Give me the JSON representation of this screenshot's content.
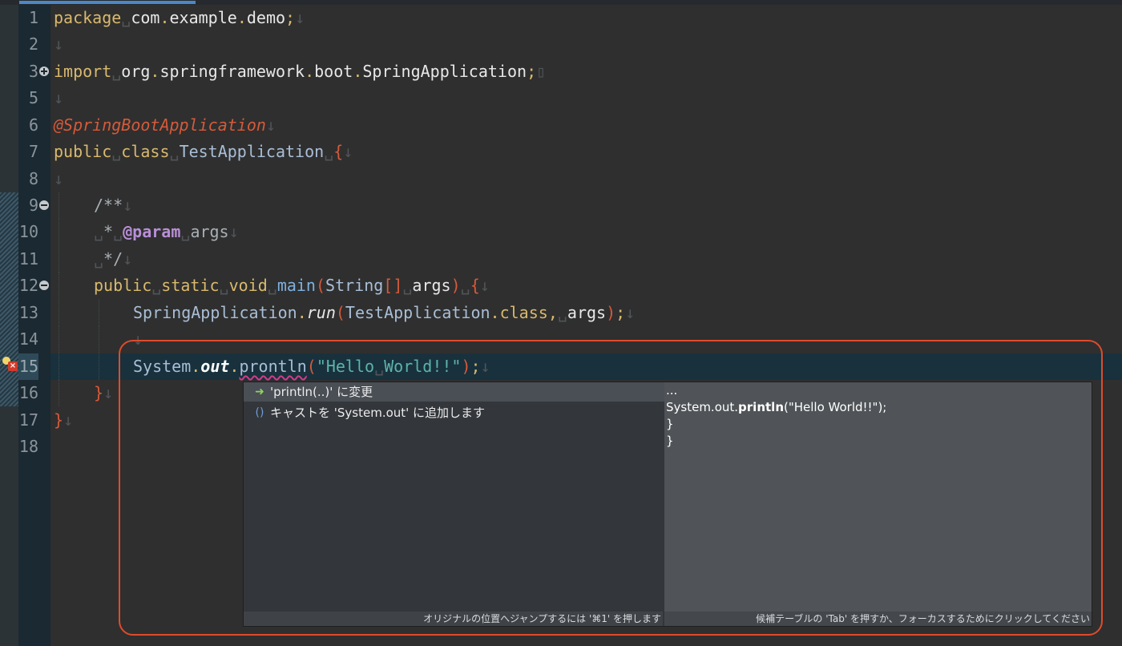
{
  "editor": {
    "lines": [
      {
        "number": "1",
        "tokens": [
          {
            "t": "package",
            "c": "kw"
          },
          {
            "t": "␣",
            "c": "ws"
          },
          {
            "t": "com",
            "c": "var"
          },
          {
            "t": ".",
            "c": "kw"
          },
          {
            "t": "example",
            "c": "var"
          },
          {
            "t": ".",
            "c": "kw"
          },
          {
            "t": "demo",
            "c": "var"
          },
          {
            "t": ";",
            "c": "kw"
          },
          {
            "t": "↓",
            "c": "ws"
          }
        ]
      },
      {
        "number": "2",
        "tokens": [
          {
            "t": "↓",
            "c": "ws"
          }
        ]
      },
      {
        "number": "3",
        "fold": "plus",
        "tokens": [
          {
            "t": "import",
            "c": "kw"
          },
          {
            "t": "␣",
            "c": "ws"
          },
          {
            "t": "org",
            "c": "var"
          },
          {
            "t": ".",
            "c": "kw"
          },
          {
            "t": "springframework",
            "c": "var"
          },
          {
            "t": ".",
            "c": "kw"
          },
          {
            "t": "boot",
            "c": "var"
          },
          {
            "t": ".",
            "c": "kw"
          },
          {
            "t": "SpringApplication",
            "c": "var"
          },
          {
            "t": ";",
            "c": "kw"
          },
          {
            "t": "▯",
            "c": "ws"
          }
        ]
      },
      {
        "number": "5",
        "tokens": [
          {
            "t": "↓",
            "c": "ws"
          }
        ]
      },
      {
        "number": "6",
        "tokens": [
          {
            "t": "@SpringBootApplication",
            "c": "an"
          },
          {
            "t": "↓",
            "c": "ws"
          }
        ]
      },
      {
        "number": "7",
        "tokens": [
          {
            "t": "public",
            "c": "kw"
          },
          {
            "t": "␣",
            "c": "ws"
          },
          {
            "t": "class",
            "c": "kw"
          },
          {
            "t": "␣",
            "c": "ws"
          },
          {
            "t": "TestApplication",
            "c": "cls"
          },
          {
            "t": "␣",
            "c": "ws"
          },
          {
            "t": "{",
            "c": "br"
          },
          {
            "t": "↓",
            "c": "ws"
          }
        ]
      },
      {
        "number": "8",
        "tokens": [
          {
            "t": "↓",
            "c": "ws"
          }
        ]
      },
      {
        "number": "9",
        "fold": "minus",
        "indent": 1,
        "tokens": [
          {
            "t": "/**",
            "c": "cm"
          },
          {
            "t": "↓",
            "c": "ws"
          }
        ]
      },
      {
        "number": "10",
        "indent": 1,
        "tokens": [
          {
            "t": "␣",
            "c": "ws"
          },
          {
            "t": "*",
            "c": "cm"
          },
          {
            "t": "␣",
            "c": "ws"
          },
          {
            "t": "@param",
            "c": "tag"
          },
          {
            "t": "␣",
            "c": "ws"
          },
          {
            "t": "args",
            "c": "cm"
          },
          {
            "t": "↓",
            "c": "ws"
          }
        ]
      },
      {
        "number": "11",
        "indent": 1,
        "tokens": [
          {
            "t": "␣",
            "c": "ws"
          },
          {
            "t": "*/",
            "c": "cm"
          },
          {
            "t": "↓",
            "c": "ws"
          }
        ]
      },
      {
        "number": "12",
        "fold": "minus",
        "indent": 1,
        "tokens": [
          {
            "t": "public",
            "c": "kw"
          },
          {
            "t": "␣",
            "c": "ws"
          },
          {
            "t": "static",
            "c": "kw"
          },
          {
            "t": "␣",
            "c": "ws"
          },
          {
            "t": "void",
            "c": "kw"
          },
          {
            "t": "␣",
            "c": "ws"
          },
          {
            "t": "main",
            "c": "meth"
          },
          {
            "t": "(",
            "c": "br"
          },
          {
            "t": "String",
            "c": "cls"
          },
          {
            "t": "[]",
            "c": "br"
          },
          {
            "t": "␣",
            "c": "ws"
          },
          {
            "t": "args",
            "c": "var"
          },
          {
            "t": ")",
            "c": "br"
          },
          {
            "t": "␣",
            "c": "ws"
          },
          {
            "t": "{",
            "c": "br"
          },
          {
            "t": "↓",
            "c": "ws"
          }
        ]
      },
      {
        "number": "13",
        "indent": 2,
        "tokens": [
          {
            "t": "SpringApplication",
            "c": "cls"
          },
          {
            "t": ".",
            "c": "kw"
          },
          {
            "t": "run",
            "c": "it"
          },
          {
            "t": "(",
            "c": "br"
          },
          {
            "t": "TestApplication",
            "c": "cls"
          },
          {
            "t": ".",
            "c": "kw"
          },
          {
            "t": "class",
            "c": "kw"
          },
          {
            "t": ",",
            "c": "kw"
          },
          {
            "t": "␣",
            "c": "ws"
          },
          {
            "t": "args",
            "c": "var"
          },
          {
            "t": ")",
            "c": "br"
          },
          {
            "t": ";",
            "c": "kw"
          },
          {
            "t": "↓",
            "c": "ws"
          }
        ]
      },
      {
        "number": "14",
        "indent": 2,
        "tokens": [
          {
            "t": "↓",
            "c": "ws"
          }
        ]
      },
      {
        "number": "15",
        "current": true,
        "indent": 2,
        "tokens": [
          {
            "t": "System",
            "c": "cls"
          },
          {
            "t": ".",
            "c": "kw"
          },
          {
            "t": "out",
            "c": "fld"
          },
          {
            "t": ".",
            "c": "kw"
          },
          {
            "t": "prontln",
            "c": "cls err"
          },
          {
            "t": "(",
            "c": "br"
          },
          {
            "t": "\"Hello",
            "c": "str"
          },
          {
            "t": "␣",
            "c": "ws"
          },
          {
            "t": "World!!\"",
            "c": "str"
          },
          {
            "t": ")",
            "c": "br"
          },
          {
            "t": ";",
            "c": "kw"
          },
          {
            "t": "↓",
            "c": "ws"
          }
        ]
      },
      {
        "number": "16",
        "indent": 1,
        "tokens": [
          {
            "t": "}",
            "c": "br"
          },
          {
            "t": "↓",
            "c": "ws"
          }
        ]
      },
      {
        "number": "17",
        "tokens": [
          {
            "t": "}",
            "c": "br"
          },
          {
            "t": "↓",
            "c": "ws"
          }
        ]
      },
      {
        "number": "18",
        "tokens": []
      }
    ]
  },
  "quickfix": {
    "items": [
      {
        "icon": "arrow-icon",
        "glyph": "➜",
        "label": "'println(..)' に変更",
        "selected": true
      },
      {
        "icon": "add-cast-icon",
        "glyph": "()",
        "label": "キャストを 'System.out' に追加します",
        "selected": false
      }
    ],
    "status_hint": "オリジナルの位置へジャンプするには '⌘1' を押します"
  },
  "preview": {
    "lines": [
      "...",
      "System.out.println(\"Hello World!!\");",
      "}",
      "}"
    ],
    "bold_word": "println",
    "status_hint": "候補テーブルの 'Tab' を押すか、フォーカスするためにクリックしてください"
  },
  "colors": {
    "highlight_box": "#e04b2b",
    "current_line": "#18313d",
    "error_underline": "#d23b8a"
  }
}
